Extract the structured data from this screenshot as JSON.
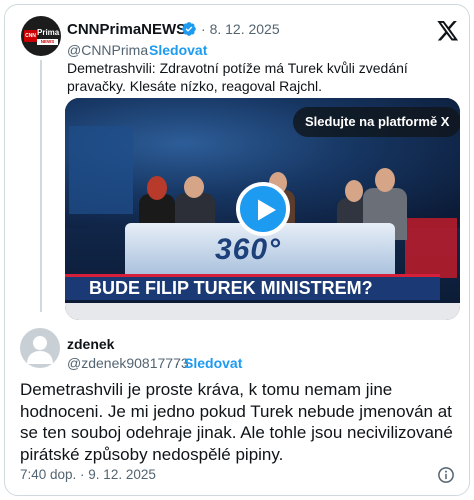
{
  "quoted_tweet": {
    "account_name": "CNNPrimaNEWS",
    "avatar": {
      "brand_cnn": "CNN",
      "brand_prima": "Prima",
      "brand_news": "NEWS"
    },
    "verified_icon": "verified-badge-icon",
    "date_separator": "·",
    "date": "8. 12. 2025",
    "handle": "@CNNPrima",
    "handle_separator": "·",
    "follow_label": "Sledovat",
    "text": "Demetrashvili: Zdravotní potíže má Turek kvůli zvedání pravačky. Klesáte nízko, reagoval Rajchl.",
    "media": {
      "watch_badge": "Sledujte na platformě X",
      "logo_text": "360°",
      "caption": "BUDE FILIP TUREK MINISTREM?",
      "play_icon": "play-icon"
    }
  },
  "platform_icon": "x-logo-icon",
  "reply_tweet": {
    "account_name": "zdenek",
    "handle": "@zdenek90817773",
    "handle_separator": "·",
    "follow_label": "Sledovat",
    "text": "Demetrashvili je proste kráva, k tomu nemam jine hodnoceni. Je mi jedno pokud Turek nebude jmenován at se ten souboj odehraje jinak. Ale tohle jsou necivilizované pirátské způsoby nedospělé pipiny.",
    "timestamp": "7:40 dop. · 9. 12. 2025",
    "info_icon": "info-icon"
  },
  "colors": {
    "accent": "#1d9bf0",
    "text_primary": "#0f1419",
    "text_secondary": "#536471",
    "border": "#cfd9de"
  }
}
